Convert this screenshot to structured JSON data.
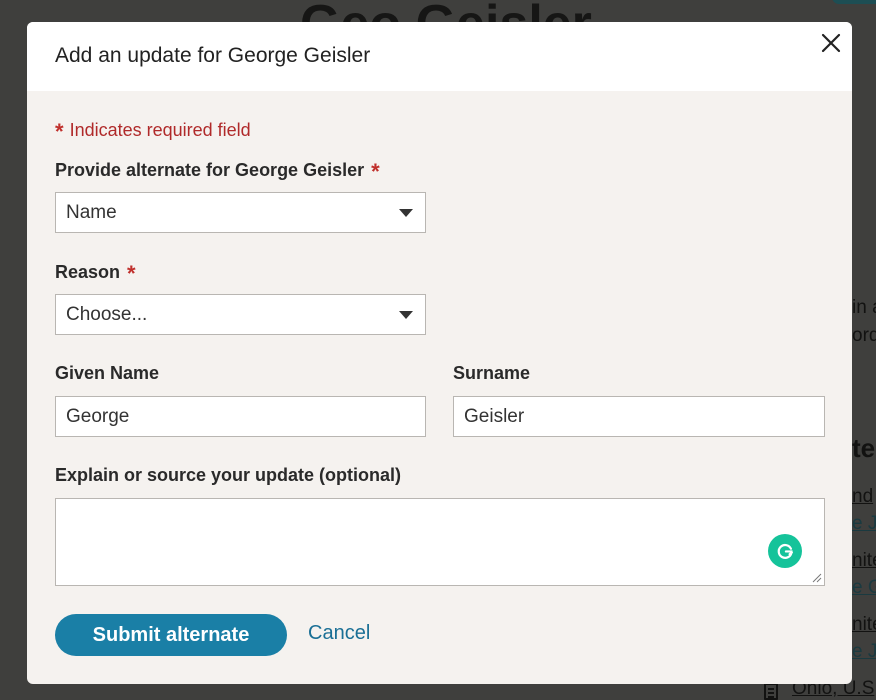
{
  "background": {
    "heading_fragment": "Geo  Geisler",
    "side_lines": [
      "in a",
      "ords"
    ],
    "section_heading_fragment": "te",
    "links": [
      "nd",
      "e J.",
      "nite",
      "e G",
      "nite",
      "e J.",
      "Ohio, U.S"
    ]
  },
  "modal": {
    "title": "Add an update for George Geisler",
    "close_icon": "close-icon",
    "required_note": "Indicates required field",
    "required_marker": "*",
    "alternate_label": "Provide alternate for George Geisler",
    "alternate_value": "Name",
    "reason_label": "Reason",
    "reason_value": "Choose...",
    "given_name_label": "Given Name",
    "given_name_value": "George",
    "surname_label": "Surname",
    "surname_value": "Geisler",
    "explain_label": "Explain or source your update (optional)",
    "explain_value": "",
    "submit_label": "Submit alternate",
    "cancel_label": "Cancel"
  },
  "colors": {
    "accent": "#1a7fa6",
    "required": "#c0302c",
    "grammarly": "#15c39a"
  }
}
